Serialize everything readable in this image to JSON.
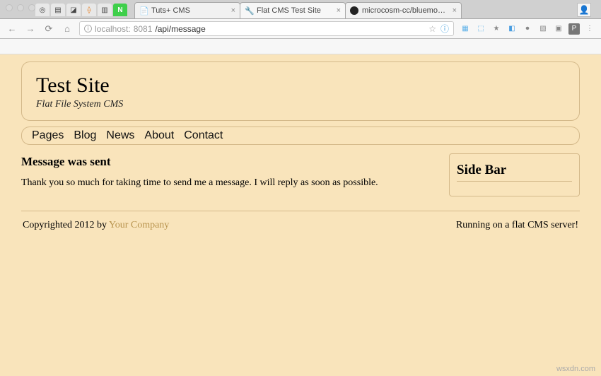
{
  "browser": {
    "tabs": [
      {
        "title": "Tuts+ CMS"
      },
      {
        "title": "Flat CMS Test Site"
      },
      {
        "title": "microcosm-cc/bluemonday: bl"
      }
    ],
    "url_host": "localhost:",
    "url_port": "8081",
    "url_path": "/api/message"
  },
  "site": {
    "title": "Test Site",
    "subtitle": "Flat File System CMS",
    "nav": [
      "Pages",
      "Blog",
      "News",
      "About",
      "Contact"
    ],
    "message": {
      "heading": "Message was sent",
      "body": "Thank you so much for taking time to send me a message. I will reply as soon as possible."
    },
    "sidebar": {
      "title": "Side Bar"
    },
    "footer": {
      "left_pre": "Copyrighted 2012 by ",
      "company": "Your Company",
      "right": "Running on a flat CMS server!"
    }
  },
  "watermark": "wsxdn.com"
}
